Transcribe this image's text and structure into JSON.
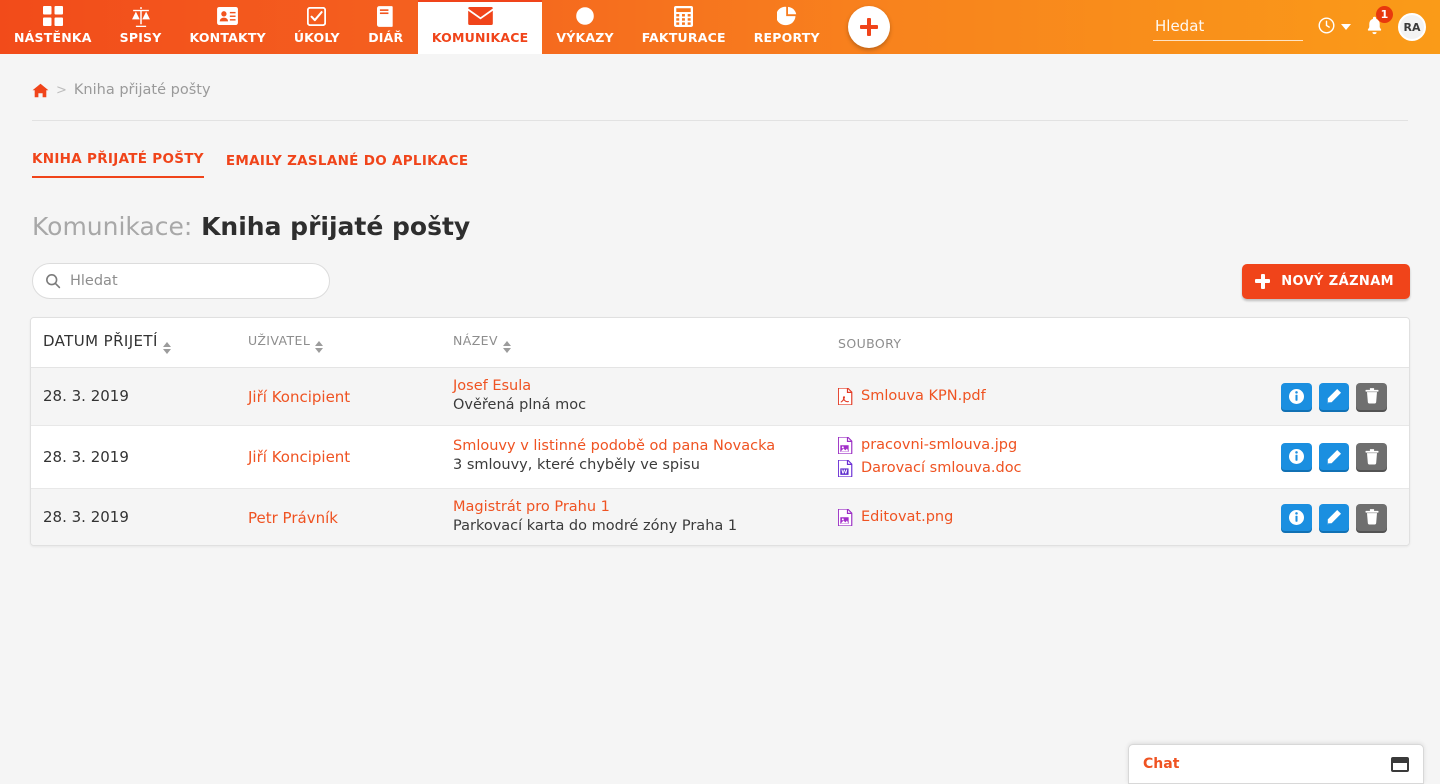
{
  "nav": {
    "items": [
      {
        "label": "NÁSTĚNKA",
        "icon": "grid-icon",
        "active": false
      },
      {
        "label": "SPISY",
        "icon": "scales-icon",
        "active": false
      },
      {
        "label": "KONTAKTY",
        "icon": "contact-card-icon",
        "active": false
      },
      {
        "label": "ÚKOLY",
        "icon": "checkbox-icon",
        "active": false
      },
      {
        "label": "DIÁŘ",
        "icon": "book-icon",
        "active": false
      },
      {
        "label": "KOMUNIKACE",
        "icon": "envelope-icon",
        "active": true
      },
      {
        "label": "VÝKAZY",
        "icon": "clock-icon",
        "active": false
      },
      {
        "label": "FAKTURACE",
        "icon": "calculator-icon",
        "active": false
      },
      {
        "label": "REPORTY",
        "icon": "pie-chart-icon",
        "active": false
      }
    ],
    "add_button": "add-icon",
    "search_placeholder": "Hledat",
    "search_value": "",
    "timer_icon": "clock-icon",
    "notifications_icon": "bell-icon",
    "notifications_count": "1",
    "avatar_initials": "RA",
    "accent_color": "#f0441a"
  },
  "breadcrumb": {
    "home_icon": "home-icon",
    "separator": ">",
    "current": "Kniha přijaté pošty"
  },
  "tabs": [
    {
      "label": "KNIHA PŘIJATÉ POŠTY",
      "active": true
    },
    {
      "label": "EMAILY ZASLANÉ DO APLIKACE",
      "active": false
    }
  ],
  "title": {
    "prefix": "Komunikace:",
    "main": "Kniha přijaté pošty"
  },
  "toolbar": {
    "search_placeholder": "Hledat",
    "search_value": "",
    "search_icon": "search-icon",
    "new_record_label": "NOVÝ ZÁZNAM"
  },
  "table": {
    "columns": [
      {
        "label": "DATUM PŘIJETÍ",
        "sortable": true
      },
      {
        "label": "UŽIVATEL",
        "sortable": true
      },
      {
        "label": "NÁZEV",
        "sortable": true
      },
      {
        "label": "SOUBORY",
        "sortable": false
      }
    ],
    "rows": [
      {
        "date": "28. 3. 2019",
        "user": "Jiří Koncipient",
        "name": "Josef Esula",
        "subtitle": "Ověřená plná moc",
        "files": [
          {
            "name": "Smlouva KPN.pdf",
            "type": "pdf"
          }
        ]
      },
      {
        "date": "28. 3. 2019",
        "user": "Jiří Koncipient",
        "name": "Smlouvy v listinné podobě od pana Novacka",
        "subtitle": "3 smlouvy, které chyběly ve spisu",
        "files": [
          {
            "name": "pracovni-smlouva.jpg",
            "type": "image"
          },
          {
            "name": "Darovací smlouva.doc",
            "type": "word"
          }
        ]
      },
      {
        "date": "28. 3. 2019",
        "user": "Petr Právník",
        "name": "Magistrát pro Prahu 1",
        "subtitle": "Parkovací karta do modré zóny Praha 1",
        "files": [
          {
            "name": "Editovat.png",
            "type": "image"
          }
        ]
      }
    ],
    "row_actions": [
      {
        "name": "info",
        "icon": "info-icon",
        "color": "#1b8fe0"
      },
      {
        "name": "edit",
        "icon": "pencil-icon",
        "color": "#1b8fe0"
      },
      {
        "name": "delete",
        "icon": "trash-icon",
        "color": "#6f6f6f"
      }
    ]
  },
  "chat": {
    "title": "Chat",
    "minimize_icon": "window-icon"
  }
}
